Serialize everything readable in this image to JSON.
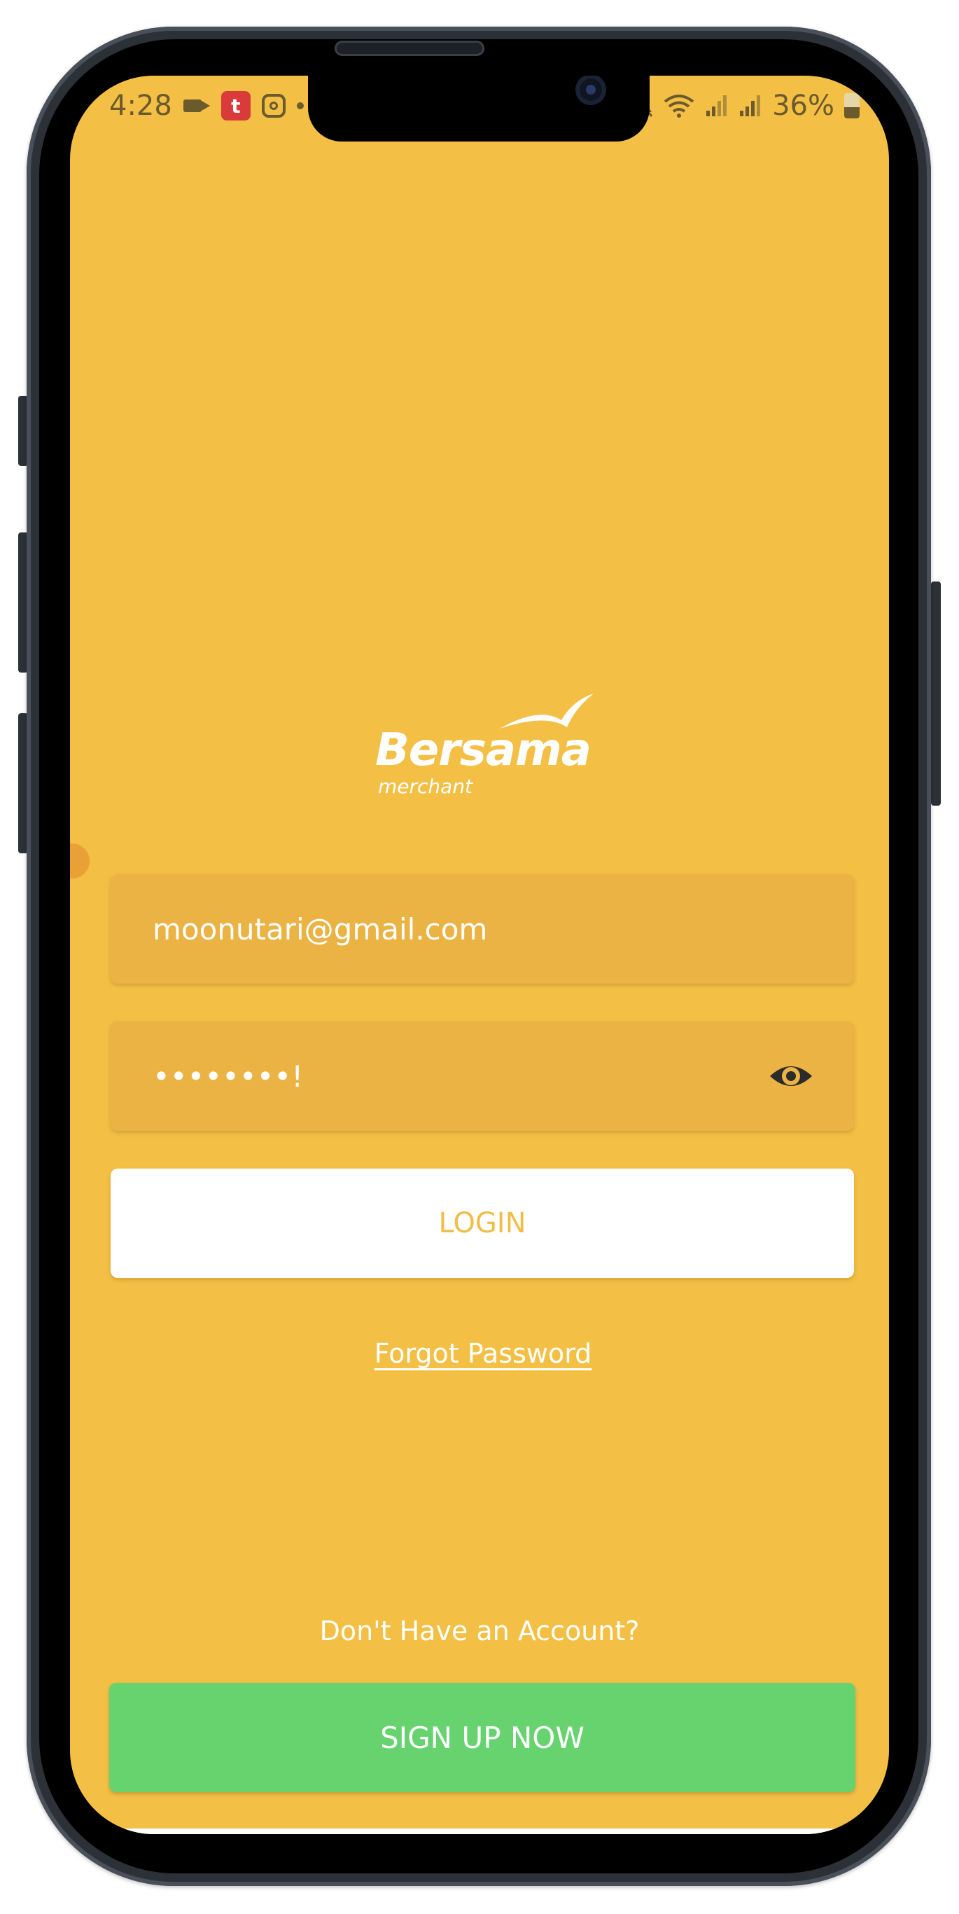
{
  "status_bar": {
    "time": "4:28",
    "battery": "36%",
    "battery_level": 0.36,
    "left_icons": [
      "video-camera-icon",
      "telkomsel-icon",
      "instagram-icon",
      "dot-icon"
    ],
    "right_icons": [
      "mute-icon",
      "wifi-icon",
      "signal-icon",
      "signal-icon",
      "battery-icon"
    ]
  },
  "logo": {
    "brand": "Bersama",
    "sub": "merchant"
  },
  "form": {
    "email_value": "moonutari@gmail.com",
    "password_value": "••••••••!",
    "show_password_icon": "eye-icon"
  },
  "actions": {
    "login_label": "LOGIN",
    "forgot_label": "Forgot Password",
    "no_account_text": "Don't Have an Account?",
    "signup_label": "SIGN UP NOW"
  },
  "colors": {
    "background": "#F3C045",
    "field": "#EBB244",
    "login_text": "#F0BE46",
    "signup": "#66D36F"
  }
}
